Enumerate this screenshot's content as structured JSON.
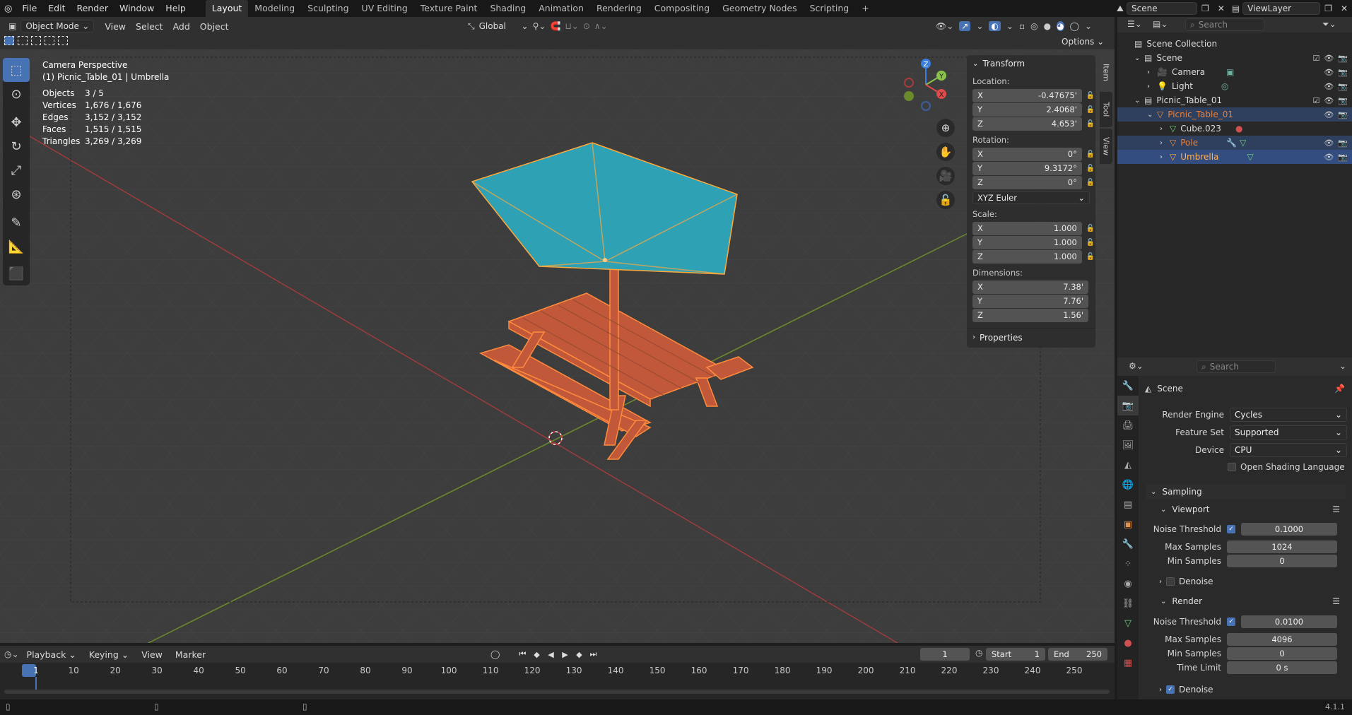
{
  "menus": [
    "File",
    "Edit",
    "Render",
    "Window",
    "Help"
  ],
  "workspaces": [
    "Layout",
    "Modeling",
    "Sculpting",
    "UV Editing",
    "Texture Paint",
    "Shading",
    "Animation",
    "Rendering",
    "Compositing",
    "Geometry Nodes",
    "Scripting"
  ],
  "active_workspace": "Layout",
  "scene_name": "Scene",
  "view_layer": "ViewLayer",
  "viewport_header": {
    "mode": "Object Mode",
    "menus": [
      "View",
      "Select",
      "Add",
      "Object"
    ],
    "orientation": "Global",
    "options": "Options"
  },
  "overlay": {
    "title": "Camera Perspective",
    "subtitle": "(1) Picnic_Table_01 | Umbrella",
    "stats": [
      {
        "k": "Objects",
        "v": "3 / 5"
      },
      {
        "k": "Vertices",
        "v": "1,676 / 1,676"
      },
      {
        "k": "Edges",
        "v": "3,152 / 3,152"
      },
      {
        "k": "Faces",
        "v": "1,515 / 1,515"
      },
      {
        "k": "Triangles",
        "v": "3,269 / 3,269"
      }
    ]
  },
  "gizmo": {
    "x": "X",
    "y": "Y",
    "z": "Z"
  },
  "npanel": {
    "transform_title": "Transform",
    "location_label": "Location:",
    "location": [
      {
        "axis": "X",
        "val": "-0.47675'"
      },
      {
        "axis": "Y",
        "val": "2.4068'"
      },
      {
        "axis": "Z",
        "val": "4.653'"
      }
    ],
    "rotation_label": "Rotation:",
    "rotation": [
      {
        "axis": "X",
        "val": "0°"
      },
      {
        "axis": "Y",
        "val": "9.3172°"
      },
      {
        "axis": "Z",
        "val": "0°"
      }
    ],
    "rotation_mode": "XYZ Euler",
    "scale_label": "Scale:",
    "scale": [
      {
        "axis": "X",
        "val": "1.000"
      },
      {
        "axis": "Y",
        "val": "1.000"
      },
      {
        "axis": "Z",
        "val": "1.000"
      }
    ],
    "dimensions_label": "Dimensions:",
    "dimensions": [
      {
        "axis": "X",
        "val": "7.38'"
      },
      {
        "axis": "Y",
        "val": "7.76'"
      },
      {
        "axis": "Z",
        "val": "1.56'"
      }
    ],
    "properties_title": "Properties",
    "tabs": [
      "Item",
      "Tool",
      "View"
    ]
  },
  "outliner": {
    "search_placeholder": "Search",
    "items": [
      {
        "label": "Scene Collection"
      },
      {
        "label": "Scene"
      },
      {
        "label": "Camera"
      },
      {
        "label": "Light"
      },
      {
        "label": "Picnic_Table_01"
      },
      {
        "label": "Picnic_Table_01"
      },
      {
        "label": "Cube.023"
      },
      {
        "label": "Pole"
      },
      {
        "label": "Umbrella"
      }
    ]
  },
  "properties": {
    "search_placeholder": "Search",
    "context": "Scene",
    "render_engine_label": "Render Engine",
    "render_engine": "Cycles",
    "feature_set_label": "Feature Set",
    "feature_set": "Supported",
    "device_label": "Device",
    "device": "CPU",
    "osl_label": "Open Shading Language",
    "sampling": "Sampling",
    "viewport": "Viewport",
    "vp_noise_label": "Noise Threshold",
    "vp_noise": "0.1000",
    "vp_max_label": "Max Samples",
    "vp_max": "1024",
    "vp_min_label": "Min Samples",
    "vp_min": "0",
    "vp_denoise": "Denoise",
    "render": "Render",
    "r_noise_label": "Noise Threshold",
    "r_noise": "0.0100",
    "r_max_label": "Max Samples",
    "r_max": "4096",
    "r_min_label": "Min Samples",
    "r_min": "0",
    "r_time_label": "Time Limit",
    "r_time": "0 s",
    "r_denoise": "Denoise"
  },
  "timeline": {
    "menus": [
      "Playback",
      "Keying",
      "View",
      "Marker"
    ],
    "current_frame": "1",
    "start_label": "Start",
    "start": "1",
    "end_label": "End",
    "end": "250",
    "ticks": [
      "1",
      "10",
      "20",
      "30",
      "40",
      "50",
      "60",
      "70",
      "80",
      "90",
      "100",
      "110",
      "120",
      "130",
      "140",
      "150",
      "160",
      "170",
      "180",
      "190",
      "200",
      "210",
      "220",
      "230",
      "240",
      "250"
    ]
  },
  "version": "4.1.1"
}
